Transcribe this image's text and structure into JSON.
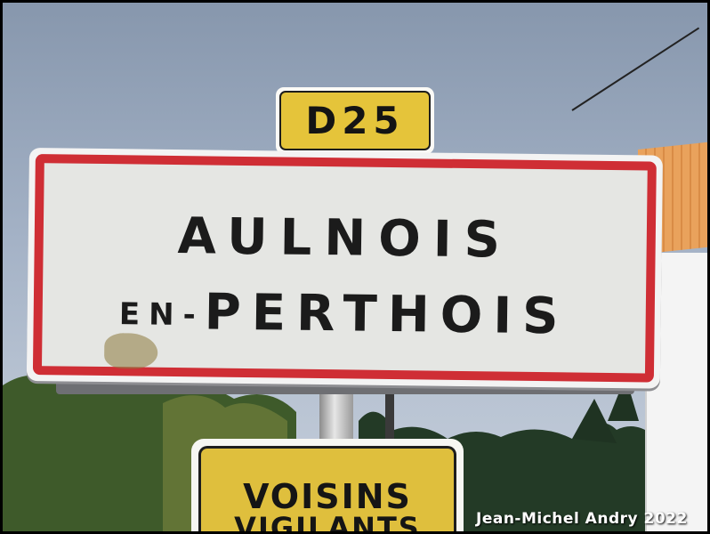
{
  "photo": {
    "road_number": "D25",
    "town_sign": {
      "line1": "AULNOIS",
      "line2_prefix": "EN-",
      "line2_main": "PERTHOIS"
    },
    "lower_sign": {
      "line1": "VOISINS",
      "line2": "VIGILANTS"
    },
    "credit": "Jean-Michel Andry 2022"
  },
  "colors": {
    "sign_red": "#cf2e35",
    "road_plate_yellow": "#e5c43a",
    "sky": "#a4b2c6"
  }
}
